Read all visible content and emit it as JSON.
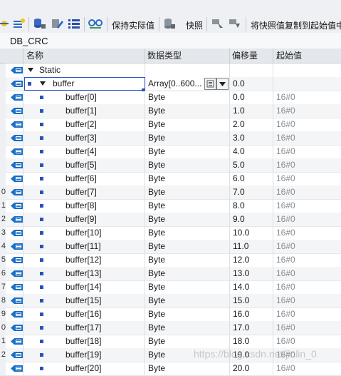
{
  "toolbar": {
    "keep_actual_label": "保持实际值",
    "snapshot_label": "快照",
    "copy_snapshot_label": "将快照值复制到起始值中"
  },
  "db_title": "DB_CRC",
  "columns": {
    "name": "名称",
    "datatype": "数据类型",
    "offset": "偏移量",
    "start_value": "起始值"
  },
  "rows": [
    {
      "num": "",
      "name": "Static",
      "type": "",
      "offset": "",
      "init": "",
      "level": 0,
      "expander": "expanded"
    },
    {
      "num": "",
      "name": "buffer",
      "type": "Array[0..600...",
      "offset": "0.0",
      "init": "",
      "level": 1,
      "expander": "expanded",
      "selected": true
    },
    {
      "num": "",
      "name": "buffer[0]",
      "type": "Byte",
      "offset": "0.0",
      "init": "16#0",
      "level": 2
    },
    {
      "num": "",
      "name": "buffer[1]",
      "type": "Byte",
      "offset": "1.0",
      "init": "16#0",
      "level": 2
    },
    {
      "num": "",
      "name": "buffer[2]",
      "type": "Byte",
      "offset": "2.0",
      "init": "16#0",
      "level": 2
    },
    {
      "num": "",
      "name": "buffer[3]",
      "type": "Byte",
      "offset": "3.0",
      "init": "16#0",
      "level": 2
    },
    {
      "num": "",
      "name": "buffer[4]",
      "type": "Byte",
      "offset": "4.0",
      "init": "16#0",
      "level": 2
    },
    {
      "num": "",
      "name": "buffer[5]",
      "type": "Byte",
      "offset": "5.0",
      "init": "16#0",
      "level": 2
    },
    {
      "num": "",
      "name": "buffer[6]",
      "type": "Byte",
      "offset": "6.0",
      "init": "16#0",
      "level": 2
    },
    {
      "num": "0",
      "name": "buffer[7]",
      "type": "Byte",
      "offset": "7.0",
      "init": "16#0",
      "level": 2
    },
    {
      "num": "1",
      "name": "buffer[8]",
      "type": "Byte",
      "offset": "8.0",
      "init": "16#0",
      "level": 2
    },
    {
      "num": "2",
      "name": "buffer[9]",
      "type": "Byte",
      "offset": "9.0",
      "init": "16#0",
      "level": 2
    },
    {
      "num": "3",
      "name": "buffer[10]",
      "type": "Byte",
      "offset": "10.0",
      "init": "16#0",
      "level": 2
    },
    {
      "num": "4",
      "name": "buffer[11]",
      "type": "Byte",
      "offset": "11.0",
      "init": "16#0",
      "level": 2
    },
    {
      "num": "5",
      "name": "buffer[12]",
      "type": "Byte",
      "offset": "12.0",
      "init": "16#0",
      "level": 2
    },
    {
      "num": "6",
      "name": "buffer[13]",
      "type": "Byte",
      "offset": "13.0",
      "init": "16#0",
      "level": 2
    },
    {
      "num": "7",
      "name": "buffer[14]",
      "type": "Byte",
      "offset": "14.0",
      "init": "16#0",
      "level": 2
    },
    {
      "num": "8",
      "name": "buffer[15]",
      "type": "Byte",
      "offset": "15.0",
      "init": "16#0",
      "level": 2
    },
    {
      "num": "9",
      "name": "buffer[16]",
      "type": "Byte",
      "offset": "16.0",
      "init": "16#0",
      "level": 2
    },
    {
      "num": "0",
      "name": "buffer[17]",
      "type": "Byte",
      "offset": "17.0",
      "init": "16#0",
      "level": 2
    },
    {
      "num": "1",
      "name": "buffer[18]",
      "type": "Byte",
      "offset": "18.0",
      "init": "16#0",
      "level": 2
    },
    {
      "num": "2",
      "name": "buffer[19]",
      "type": "Byte",
      "offset": "19.0",
      "init": "16#0",
      "level": 2
    },
    {
      "num": "",
      "name": "buffer[20]",
      "type": "Byte",
      "offset": "20.0",
      "init": "16#0",
      "level": 2
    }
  ],
  "watermark": "https://blog.csdn.net/jinlin_0",
  "colors": {
    "accent": "#2a52be",
    "row_icon": "#1b6fc7",
    "header_bg": "#e4e8ec",
    "toolbar_bg": "#eef0f3"
  },
  "icons": {
    "row": "data-block-row-icon",
    "expand": "expand-triangle-icon",
    "element": "element-square-icon"
  }
}
